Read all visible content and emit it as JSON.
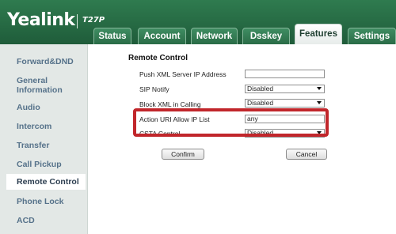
{
  "brand": {
    "logo": "Yealink",
    "model": "T27P"
  },
  "tabs": [
    {
      "label": "Status"
    },
    {
      "label": "Account"
    },
    {
      "label": "Network"
    },
    {
      "label": "Dsskey"
    },
    {
      "label": "Features"
    },
    {
      "label": "Settings"
    }
  ],
  "active_tab": "Features",
  "sidebar": {
    "items": [
      {
        "label": "Forward&DND"
      },
      {
        "label": "General Information"
      },
      {
        "label": "Audio"
      },
      {
        "label": "Intercom"
      },
      {
        "label": "Transfer"
      },
      {
        "label": "Call Pickup"
      },
      {
        "label": "Remote Control"
      },
      {
        "label": "Phone Lock"
      },
      {
        "label": "ACD"
      }
    ],
    "active": "Remote Control"
  },
  "main": {
    "section_title": "Remote Control",
    "rows": [
      {
        "label": "Push XML Server IP Address",
        "value": ""
      },
      {
        "label": "SIP Notify",
        "value": "Disabled"
      },
      {
        "label": "Block XML in Calling",
        "value": "Disabled"
      },
      {
        "label": "Action URI Allow IP List",
        "value": "any"
      },
      {
        "label": "CSTA Control",
        "value": "Disabled"
      }
    ],
    "confirm_label": "Confirm",
    "cancel_label": "Cancel"
  },
  "colors": {
    "header": "#226443",
    "highlight": "#c1262b",
    "sidebar_bg": "#e3e8e6",
    "sidebar_text": "#56728a"
  }
}
